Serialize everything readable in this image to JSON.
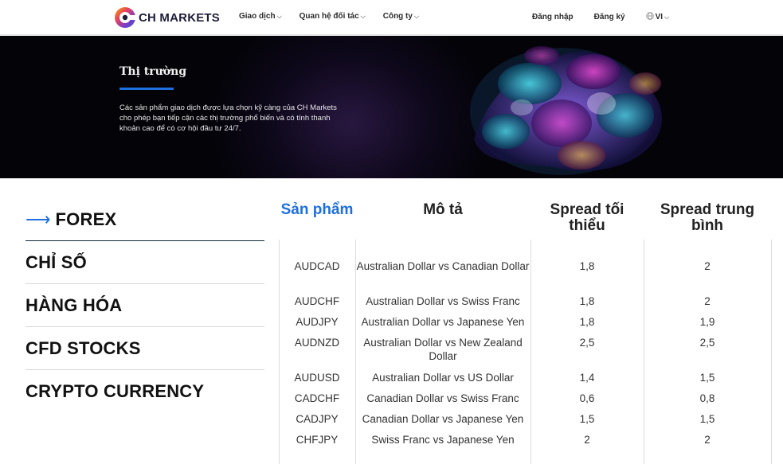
{
  "header": {
    "logo_text": "CH MARKETS",
    "nav": [
      {
        "label": "Giao dịch"
      },
      {
        "label": "Quan hệ đối tác"
      },
      {
        "label": "Công ty"
      }
    ],
    "login": "Đăng nhập",
    "register": "Đăng ký",
    "lang": "VI"
  },
  "hero": {
    "title": "Thị trường",
    "description": "Các sản phẩm giao dịch được lựa chọn kỹ càng của CH Markets cho phép bạn tiếp cận các thị trường phổ biến và có tính thanh khoản cao để có cơ hội đầu tư 24/7."
  },
  "categories": [
    {
      "label": "FOREX",
      "active": true
    },
    {
      "label": "CHỈ SỐ"
    },
    {
      "label": "HÀNG HÓA"
    },
    {
      "label": "CFD STOCKS"
    },
    {
      "label": "CRYPTO CURRENCY"
    }
  ],
  "table": {
    "headers": [
      "Sản phẩm",
      "Mô tả",
      "Spread tối thiểu",
      "Spread trung bình"
    ],
    "rows": [
      {
        "product": "AUDCAD",
        "desc": "Australian Dollar vs Canadian Dollar",
        "min": "1,8",
        "avg": "2"
      },
      {
        "product": "AUDCHF",
        "desc": "Australian Dollar vs Swiss Franc",
        "min": "1,8",
        "avg": "2"
      },
      {
        "product": "AUDJPY",
        "desc": "Australian Dollar vs Japanese Yen",
        "min": "1,8",
        "avg": "1,9"
      },
      {
        "product": "AUDNZD",
        "desc": "Australian Dollar vs New Zealand Dollar",
        "min": "2,5",
        "avg": "2,5"
      },
      {
        "product": "AUDUSD",
        "desc": "Australian Dollar vs US Dollar",
        "min": "1,4",
        "avg": "1,5"
      },
      {
        "product": "CADCHF",
        "desc": "Canadian Dollar vs Swiss Franc",
        "min": "0,6",
        "avg": "0,8"
      },
      {
        "product": "CADJPY",
        "desc": "Canadian Dollar vs Japanese Yen",
        "min": "1,5",
        "avg": "1,5"
      },
      {
        "product": "CHFJPY",
        "desc": "Swiss Franc vs Japanese Yen",
        "min": "2",
        "avg": "2"
      }
    ]
  },
  "colors": {
    "accent": "#1e6fe0",
    "hero_bg": "#030308"
  }
}
